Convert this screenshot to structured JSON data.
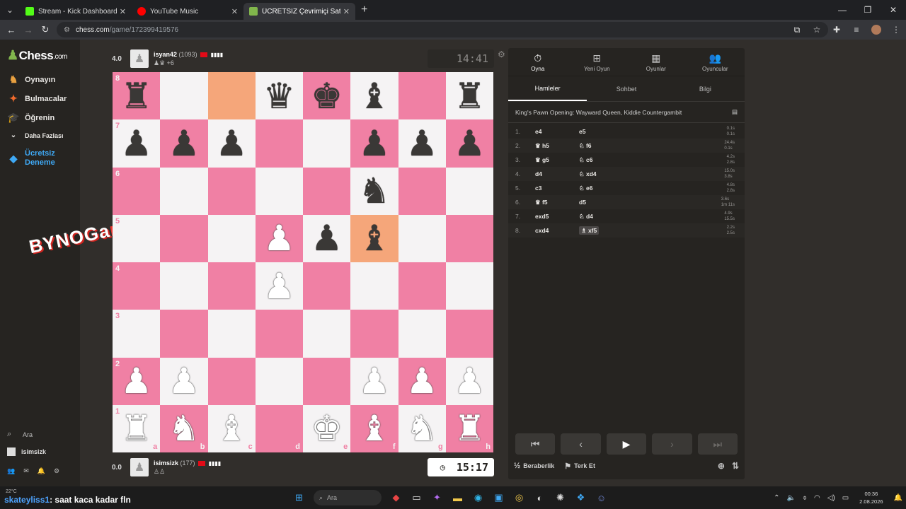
{
  "browser": {
    "tabs": [
      {
        "title": "Stream - Kick Dashboard",
        "color": "#53fc18"
      },
      {
        "title": "YouTube Music",
        "color": "#ff0000"
      },
      {
        "title": "ÜCRETSİZ Çevrimiçi Satranç Oy",
        "color": "#81b64c"
      }
    ],
    "url_host": "chess.com",
    "url_path": "/game/172399419576"
  },
  "sidebar": {
    "logo_text": "Chess",
    "logo_suffix": ".com",
    "items": [
      {
        "label": "Oynayın",
        "icon": "play-icon"
      },
      {
        "label": "Bulmacalar",
        "icon": "puzzle-icon"
      },
      {
        "label": "Öğrenin",
        "icon": "learn-icon"
      },
      {
        "label": "Daha Fazlası",
        "icon": "chevron-down-icon"
      }
    ],
    "trial_line1": "Ücretsiz",
    "trial_line2": "Deneme",
    "search_label": "Ara",
    "username": "isimsizk"
  },
  "watermark": {
    "text": "BYNOGa",
    "accent": "m"
  },
  "top_player": {
    "score": "4.0",
    "name": "isyan42",
    "rating": "(1093)",
    "captured": "+6",
    "clock": "14:41"
  },
  "bottom_player": {
    "score": "0.0",
    "name": "isimsizk",
    "rating": "(177)",
    "clock": "15:17"
  },
  "board": {
    "light_color": "#f5f3f4",
    "dark_color": "#f080a4",
    "highlight_color": "#f5a67a",
    "highlighted": [
      "c8",
      "f5"
    ],
    "pieces": {
      "a8": "bR",
      "d8": "bQ",
      "e8": "bK",
      "f8": "bB",
      "h8": "bR",
      "a7": "bP",
      "b7": "bP",
      "c7": "bP",
      "f7": "bP",
      "g7": "bP",
      "h7": "bP",
      "f6": "bN",
      "d5": "wP",
      "e5": "bP",
      "f5": "bB",
      "d4": "wP",
      "a2": "wP",
      "b2": "wP",
      "f2": "wP",
      "g2": "wP",
      "h2": "wP",
      "a1": "wR",
      "b1": "wN",
      "c1": "wB",
      "e1": "wK",
      "f1": "wB",
      "g1": "wN",
      "h1": "wR"
    }
  },
  "panel": {
    "tabs": [
      {
        "label": "Oyna",
        "icon": "clock-icon"
      },
      {
        "label": "Yeni Oyun",
        "icon": "plus-icon"
      },
      {
        "label": "Oyunlar",
        "icon": "board-icon"
      },
      {
        "label": "Oyuncular",
        "icon": "players-icon"
      }
    ],
    "subtabs": [
      "Hamleler",
      "Sohbet",
      "Bilgi"
    ],
    "opening": "King's Pawn Opening: Wayward Queen, Kiddie Countergambit",
    "moves": [
      {
        "n": "1.",
        "w": "e4",
        "wp": "",
        "b": "e5",
        "bp": "",
        "tw": "0.1s",
        "tb": "0.1s"
      },
      {
        "n": "2.",
        "w": "h5",
        "wp": "♛",
        "b": "f6",
        "bp": "♘",
        "tw": "24.4s",
        "tb": "0.1s"
      },
      {
        "n": "3.",
        "w": "g5",
        "wp": "♛",
        "b": "c6",
        "bp": "♘",
        "tw": "4.2s",
        "tb": "2.8s"
      },
      {
        "n": "4.",
        "w": "d4",
        "wp": "",
        "b": "xd4",
        "bp": "♘",
        "tw": "15.0s",
        "tb": "3.8s"
      },
      {
        "n": "5.",
        "w": "c3",
        "wp": "",
        "b": "e6",
        "bp": "♘",
        "tw": "4.8s",
        "tb": "2.8s"
      },
      {
        "n": "6.",
        "w": "f5",
        "wp": "♛",
        "b": "d5",
        "bp": "",
        "tw": "3.6s",
        "tb": "1m 11s"
      },
      {
        "n": "7.",
        "w": "exd5",
        "wp": "",
        "b": "d4",
        "bp": "♘",
        "tw": "4.9s",
        "tb": "15.5s"
      },
      {
        "n": "8.",
        "w": "cxd4",
        "wp": "",
        "b": "xf5",
        "bp": "♗",
        "tw": "2.2s",
        "tb": "2.5s"
      }
    ],
    "draw_label": "Beraberlik",
    "draw_icon": "½",
    "resign_label": "Terk Et"
  },
  "taskbar": {
    "weather": "22°C",
    "chat_user": "skateyliss1",
    "chat_msg": ": saat kaca kadar fln",
    "search": "Ara",
    "time": "00:36",
    "date": "2.08.2026"
  }
}
